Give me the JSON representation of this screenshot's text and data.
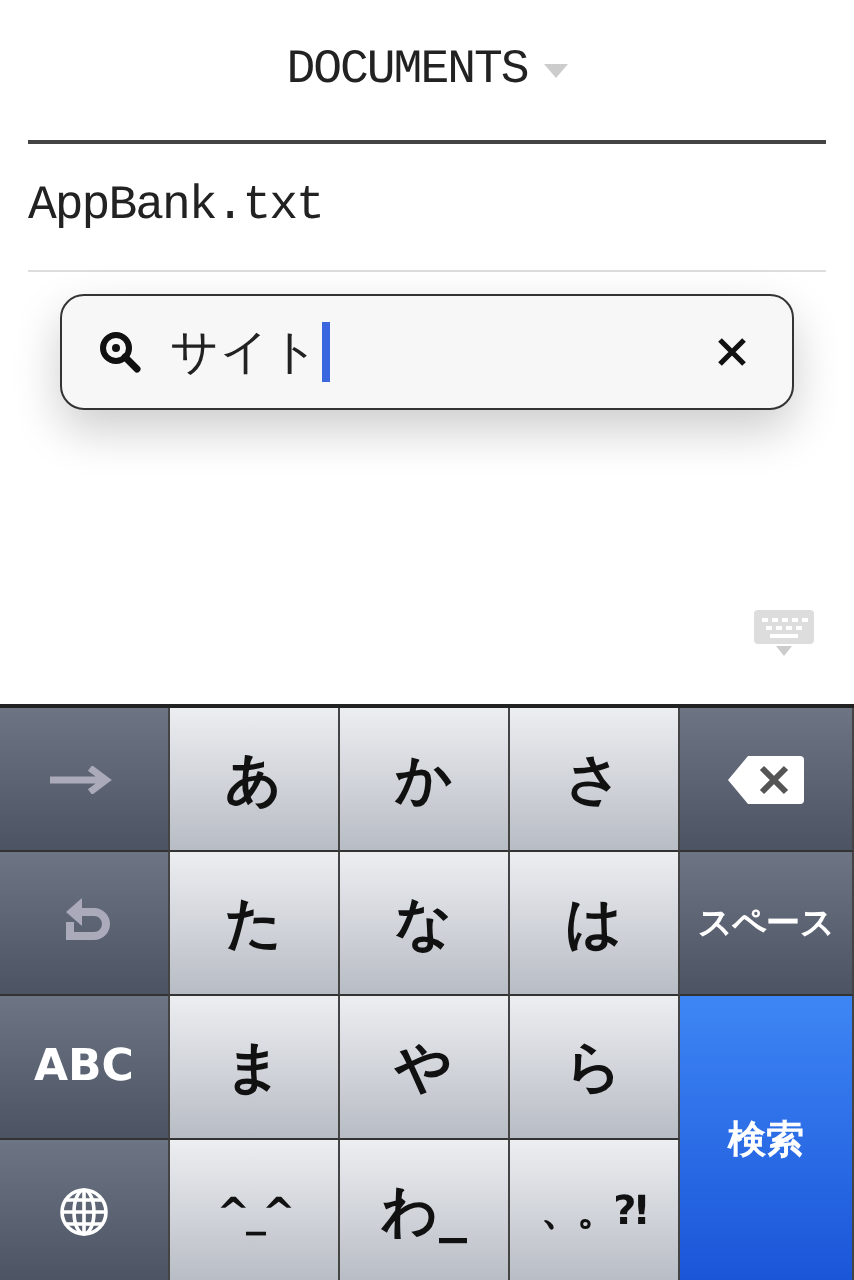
{
  "header": {
    "title": "DOCUMENTS"
  },
  "documents": [
    {
      "name": "AppBank.txt"
    }
  ],
  "search": {
    "value": "サイト"
  },
  "keyboard": {
    "keys": [
      {
        "kind": "arrow"
      },
      {
        "kind": "char",
        "label": "あ"
      },
      {
        "kind": "char",
        "label": "か"
      },
      {
        "kind": "char",
        "label": "さ"
      },
      {
        "kind": "delete"
      },
      {
        "kind": "undo"
      },
      {
        "kind": "char",
        "label": "た"
      },
      {
        "kind": "char",
        "label": "な"
      },
      {
        "kind": "char",
        "label": "は"
      },
      {
        "kind": "dark",
        "label": "スペース"
      },
      {
        "kind": "dark",
        "label": "ABC"
      },
      {
        "kind": "char",
        "label": "ま"
      },
      {
        "kind": "char",
        "label": "や"
      },
      {
        "kind": "char",
        "label": "ら"
      },
      {
        "kind": "action",
        "label": "検索"
      },
      {
        "kind": "globe"
      },
      {
        "kind": "char",
        "label": "^_^"
      },
      {
        "kind": "char",
        "label": "わ_"
      },
      {
        "kind": "char",
        "label": "、。?!"
      }
    ]
  }
}
